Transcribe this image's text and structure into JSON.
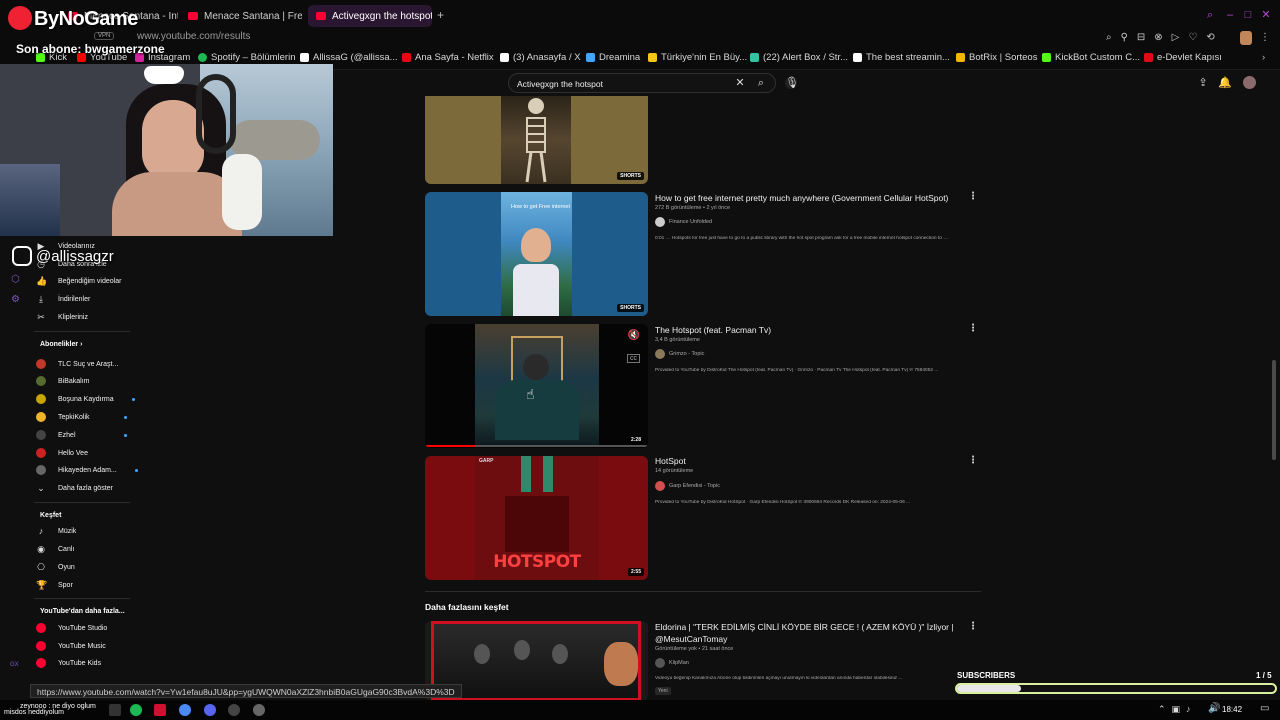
{
  "stream": {
    "brand": "ByNoGame",
    "last_sub_label": "Son abone: bwgamerzone",
    "instagram": "@allissagzr",
    "subscribers_label": "SUBSCRIBERS",
    "subscribers_progress": "1 / 5",
    "chat_line": "zeynooo : ne diyo oglum",
    "chat_line2": "misdos  neddiyolum"
  },
  "browser": {
    "tabs": [
      {
        "label": "Menace Santana - Into the"
      },
      {
        "label": "Menace Santana | Freest"
      },
      {
        "label": "Activegxgn the hotspot -"
      }
    ],
    "vpn": "VPN",
    "url": "www.youtube.com/results",
    "status_url": "https://www.youtube.com/watch?v=Yw1efau8uJU&pp=ygUWQWN0aXZlZ3hnbiB0aGUgaG90c3BvdA%3D%3D",
    "bookmarks": [
      {
        "label": "Kick",
        "color": "#53fc18"
      },
      {
        "label": "YouTube",
        "color": "#ff0000"
      },
      {
        "label": "Instagram",
        "color": "#d6249f"
      },
      {
        "label": "Spotify – Bölümlerin",
        "color": "#1db954"
      },
      {
        "label": "AllissaG (@allissa...",
        "color": "#ffffff"
      },
      {
        "label": "Ana Sayfa - Netflix",
        "color": "#e50914"
      },
      {
        "label": "(3) Anasayfa / X",
        "color": "#ffffff"
      },
      {
        "label": "Dreamina",
        "color": "#3fa7ff"
      },
      {
        "label": "Türkiye'nin En Büy...",
        "color": "#f5c518"
      },
      {
        "label": "(22) Alert Box / Str...",
        "color": "#31c3a2"
      },
      {
        "label": "The best streamin...",
        "color": "#ffffff"
      },
      {
        "label": "BotRix | Sorteos",
        "color": "#f7b500"
      },
      {
        "label": "KickBot Custom C...",
        "color": "#53fc18"
      },
      {
        "label": "e-Devlet Kapısı",
        "color": "#e30a17"
      }
    ]
  },
  "youtube": {
    "search_query": "Activegxgn the hotspot",
    "sidebar": {
      "top_items": [
        {
          "label": "Videolarınız",
          "icon": "video-icon"
        },
        {
          "label": "Daha sonra izle",
          "icon": "clock-icon"
        },
        {
          "label": "Beğendiğim videolar",
          "icon": "thumb-up-icon"
        },
        {
          "label": "İndirilenler",
          "icon": "download-icon"
        },
        {
          "label": "Klipleriniz",
          "icon": "scissors-icon"
        }
      ],
      "subs_heading": "Abonelikler",
      "subscriptions": [
        {
          "label": "TLC Suç ve Araşt...",
          "color": "#c0392b"
        },
        {
          "label": "BiBakalım",
          "color": "#556b2f"
        },
        {
          "label": "Boşuna Kaydırma",
          "color": "#c8a600"
        },
        {
          "label": "TepkiKolik",
          "color": "#f0b429"
        },
        {
          "label": "Ezhel",
          "color": "#444444"
        },
        {
          "label": "Hello Vee",
          "color": "#cc2222"
        },
        {
          "label": "Hikayeden Adam...",
          "color": "#666666"
        },
        {
          "label": "Daha fazla göster",
          "color": ""
        }
      ],
      "explore_heading": "Keşfet",
      "explore": [
        {
          "label": "Müzik",
          "icon": "music-icon"
        },
        {
          "label": "Canlı",
          "icon": "live-icon"
        },
        {
          "label": "Oyun",
          "icon": "gamepad-icon"
        },
        {
          "label": "Spor",
          "icon": "trophy-icon"
        }
      ],
      "more_heading": "YouTube'dan daha fazla...",
      "more": [
        {
          "label": "YouTube Studio"
        },
        {
          "label": "YouTube Music"
        },
        {
          "label": "YouTube Kids"
        }
      ]
    },
    "results": [
      {
        "badge": "SHORTS"
      },
      {
        "title": "How to get free internet pretty much anywhere (Government Cellular HotSpot)",
        "meta": "272 B görüntüleme • 2 yıl önce",
        "channel": "Finance Unfolded",
        "desc": "0:01 … Hotspots for free just have to go to a public library with the hot spot program ask for a free mobile internet hotspot connection to …",
        "badge": "SHORTS",
        "thumb_text": "How to get Free internet"
      },
      {
        "title": "The Hotspot (feat. Pacman Tv)",
        "meta": "3,4 B görüntüleme",
        "channel": "Grimzo - Topic",
        "desc": "Provided to YouTube by DistroKid The Hotspot (feat. Pacman Tv) · Grimzo · Pacman Tv The Hotspot (feat. Pacman Tv) ℗ 7584052 ...",
        "badge": "2:28"
      },
      {
        "title": "HotSpot",
        "meta": "14 görüntüleme",
        "channel": "Garp Efendisi - Topic",
        "desc": "Provided to YouTube by DistroKid HotSpot · Garp Efendisi HotSpot ℗ 3900694 Records DK Released on: 2024-05-06 ...",
        "badge": "2:55",
        "thumb_text": "HOTSPOT",
        "thumb_top": "GARP"
      }
    ],
    "explore_more": "Daha fazlasını keşfet",
    "explore_video": {
      "title": "Eldorina | \"TERK EDİLMİŞ CİNLİ KÖYDE BİR GECE ! ( AZEM KÖYÜ )\" İzliyor |",
      "title2": "@MesutCanTomay",
      "meta": "Görüntüleme yok • 21 saat önce",
      "channel": "KlipMan",
      "desc": "Videoyu beğenip Kanalımıza Abone olup bildirimleri açmayı unutmayın ki videolardan anında haberdar olabilesiniz ...",
      "tag": "Yeni"
    }
  },
  "taskbar": {
    "time": "18:42"
  }
}
